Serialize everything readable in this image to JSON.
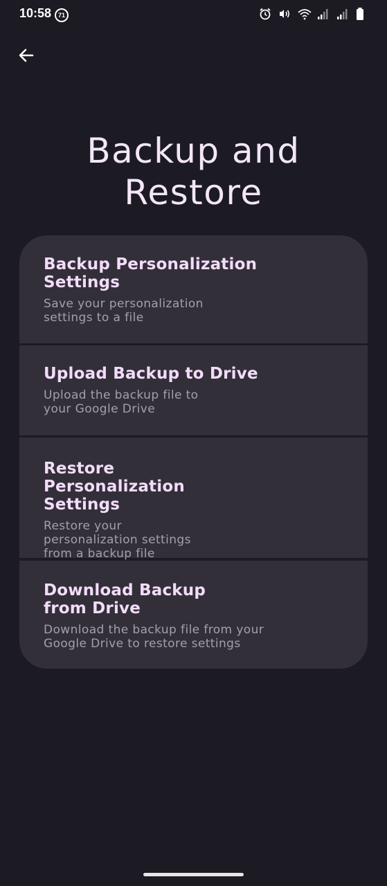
{
  "status_bar": {
    "time": "10:58",
    "badge": "71",
    "icons": [
      "alarm-icon",
      "nfc-icon",
      "wifi-icon",
      "signal-icon",
      "signal-icon",
      "battery-icon"
    ]
  },
  "header": {
    "back_icon": "arrow-left-icon",
    "title": "Backup and Restore"
  },
  "options": [
    {
      "title": "Backup Personalization Settings",
      "description": "Save your personalization settings to a file"
    },
    {
      "title": "Upload Backup to Drive",
      "description": "Upload the backup file to your Google Drive"
    },
    {
      "title": "Restore Personalization Settings",
      "description": "Restore your personalization settings from a backup file"
    },
    {
      "title": "Download Backup from Drive",
      "description": "Download the backup file from your Google Drive to restore settings"
    }
  ],
  "colors": {
    "background": "#1c1a22",
    "card": "#332f39",
    "title": "#f3dcfa",
    "description": "#a59fab"
  }
}
